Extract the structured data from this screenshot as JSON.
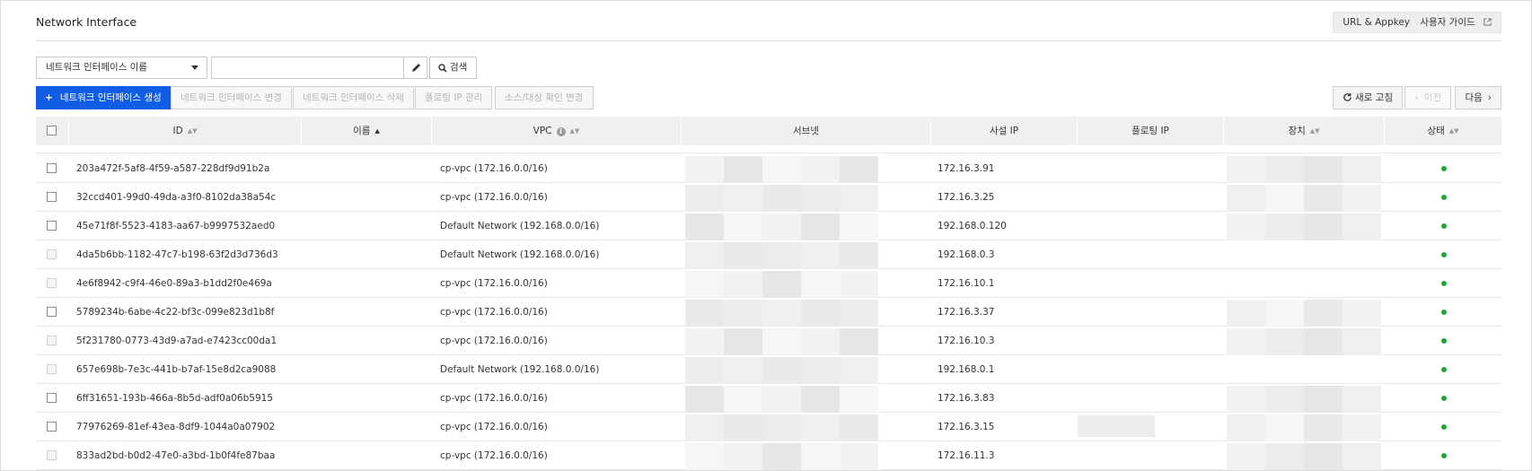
{
  "header": {
    "title": "Network Interface",
    "url_appkey_label": "URL & Appkey",
    "user_guide_label": "사용자 가이드"
  },
  "search": {
    "filter_selected": "네트워크 인터페이스 이름",
    "input_value": "",
    "search_label": "검색"
  },
  "actions": {
    "create_label": "네트워크 인터페이스 생성",
    "change_label": "네트워크 인터페이스 변경",
    "delete_label": "네트워크 인터페이스 삭제",
    "floating_ip_label": "플로팅 IP 관리",
    "source_target_label": "소스/대상 확인 변경",
    "refresh_label": "새로 고침",
    "prev_label": "이전",
    "next_label": "다음"
  },
  "table": {
    "columns": {
      "id": "ID",
      "name": "이름",
      "vpc": "VPC",
      "subnet": "서브넷",
      "private_ip": "사설 IP",
      "floating_ip": "플로팅 IP",
      "device": "장치",
      "status": "상태"
    },
    "rows": [
      {
        "id": "203a472f-5af8-4f59-a587-228df9d91b2a",
        "vpc": "cp-vpc (172.16.0.0/16)",
        "private_ip": "172.16.3.91",
        "checkbox_enabled": true,
        "status_color": "#22a335"
      },
      {
        "id": "32ccd401-99d0-49da-a3f0-8102da38a54c",
        "vpc": "cp-vpc (172.16.0.0/16)",
        "private_ip": "172.16.3.25",
        "checkbox_enabled": true,
        "status_color": "#22a335"
      },
      {
        "id": "45e71f8f-5523-4183-aa67-b9997532aed0",
        "vpc": "Default Network (192.168.0.0/16)",
        "private_ip": "192.168.0.120",
        "checkbox_enabled": true,
        "status_color": "#22a335"
      },
      {
        "id": "4da5b6bb-1182-47c7-b198-63f2d3d736d3",
        "vpc": "Default Network (192.168.0.0/16)",
        "private_ip": "192.168.0.3",
        "checkbox_enabled": false,
        "status_color": "#22a335"
      },
      {
        "id": "4e6f8942-c9f4-46e0-89a3-b1dd2f0e469a",
        "vpc": "cp-vpc (172.16.0.0/16)",
        "private_ip": "172.16.10.1",
        "checkbox_enabled": false,
        "status_color": "#22a335"
      },
      {
        "id": "5789234b-6abe-4c22-bf3c-099e823d1b8f",
        "vpc": "cp-vpc (172.16.0.0/16)",
        "private_ip": "172.16.3.37",
        "checkbox_enabled": true,
        "status_color": "#22a335"
      },
      {
        "id": "5f231780-0773-43d9-a7ad-e7423cc00da1",
        "vpc": "cp-vpc (172.16.0.0/16)",
        "private_ip": "172.16.10.3",
        "checkbox_enabled": false,
        "status_color": "#22a335"
      },
      {
        "id": "657e698b-7e3c-441b-b7af-15e8d2ca9088",
        "vpc": "Default Network (192.168.0.0/16)",
        "private_ip": "192.168.0.1",
        "checkbox_enabled": false,
        "status_color": "#22a335"
      },
      {
        "id": "6ff31651-193b-466a-8b5d-adf0a06b5915",
        "vpc": "cp-vpc (172.16.0.0/16)",
        "private_ip": "172.16.3.83",
        "checkbox_enabled": true,
        "status_color": "#22a335"
      },
      {
        "id": "77976269-81ef-43ea-8df9-1044a0a07902",
        "vpc": "cp-vpc (172.16.0.0/16)",
        "private_ip": "172.16.3.15",
        "checkbox_enabled": true,
        "status_color": "#22a335"
      },
      {
        "id": "833ad2bd-b0d2-47e0-a3bd-1b0f4fe87baa",
        "vpc": "cp-vpc (172.16.0.0/16)",
        "private_ip": "172.16.11.3",
        "checkbox_enabled": false,
        "status_color": "#22a335"
      }
    ]
  },
  "colors": {
    "primary": "#125de6",
    "status_ok": "#22a335",
    "header_bg": "#f0f0f0"
  }
}
